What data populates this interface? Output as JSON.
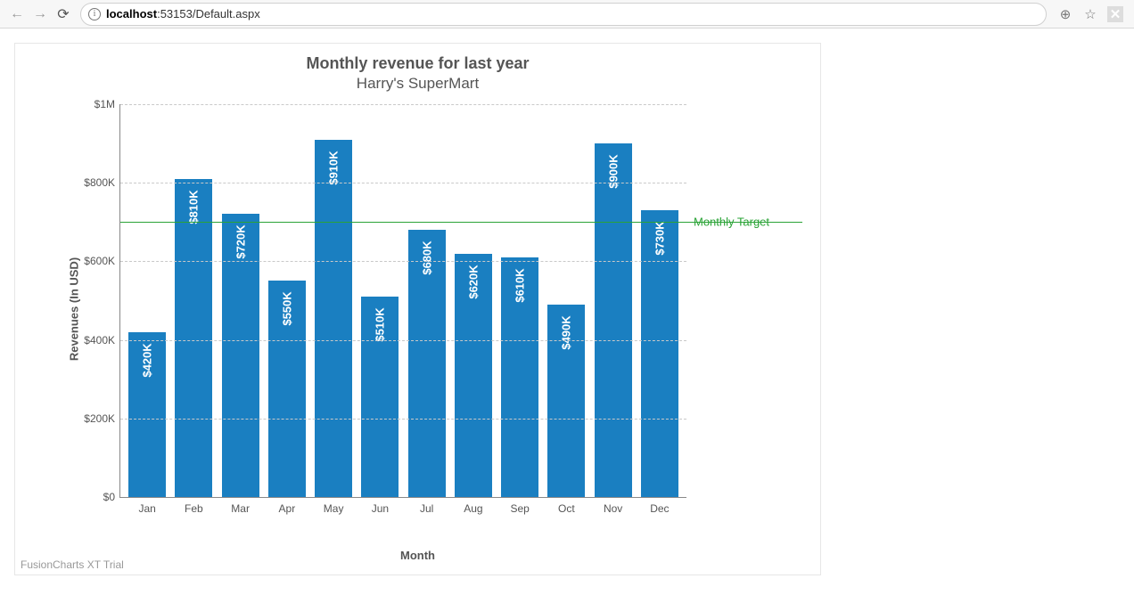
{
  "browser": {
    "url_host": "localhost",
    "url_rest": ":53153/Default.aspx",
    "info_glyph": "i",
    "back_glyph": "←",
    "forward_glyph": "→",
    "reload_glyph": "⟳",
    "zoom_glyph": "⊕",
    "star_glyph": "☆",
    "pdf_glyph": "✕"
  },
  "chart_data": {
    "type": "bar",
    "title": "Monthly revenue for last year",
    "subtitle": "Harry's SuperMart",
    "xlabel": "Month",
    "ylabel": "Revenues (In USD)",
    "ylim": [
      0,
      1000000
    ],
    "y_ticks": [
      {
        "v": 0,
        "label": "$0"
      },
      {
        "v": 200000,
        "label": "$200K"
      },
      {
        "v": 400000,
        "label": "$400K"
      },
      {
        "v": 600000,
        "label": "$600K"
      },
      {
        "v": 800000,
        "label": "$800K"
      },
      {
        "v": 1000000,
        "label": "$1M"
      }
    ],
    "categories": [
      "Jan",
      "Feb",
      "Mar",
      "Apr",
      "May",
      "Jun",
      "Jul",
      "Aug",
      "Sep",
      "Oct",
      "Nov",
      "Dec"
    ],
    "values": [
      420000,
      810000,
      720000,
      550000,
      910000,
      510000,
      680000,
      620000,
      610000,
      490000,
      900000,
      730000
    ],
    "value_labels": [
      "$420K",
      "$810K",
      "$720K",
      "$550K",
      "$910K",
      "$510K",
      "$680K",
      "$620K",
      "$610K",
      "$490K",
      "$900K",
      "$730K"
    ],
    "target": {
      "value": 700000,
      "label": "Monthly Target"
    },
    "watermark": "FusionCharts XT Trial"
  }
}
